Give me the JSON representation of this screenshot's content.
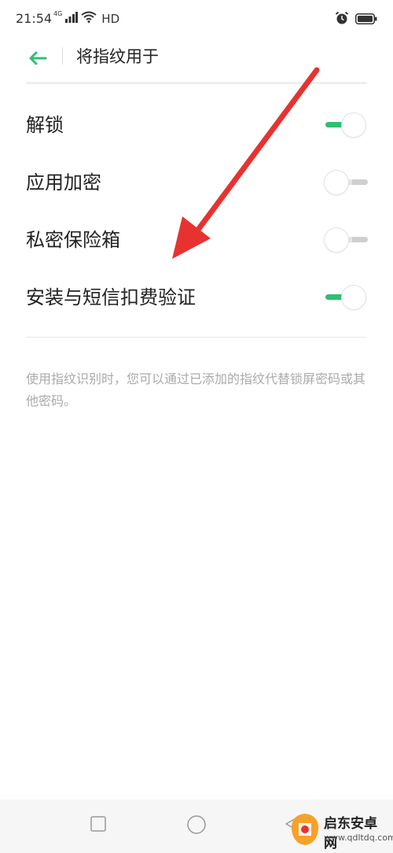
{
  "status_bar": {
    "time": "21:54",
    "network": "4G",
    "hd": "HD",
    "icons": [
      "signal-icon",
      "wifi-icon",
      "alarm-icon",
      "battery-icon"
    ]
  },
  "header": {
    "back_icon": "arrow-left-icon",
    "title": "将指纹用于"
  },
  "settings": [
    {
      "label": "解锁",
      "enabled": true
    },
    {
      "label": "应用加密",
      "enabled": false
    },
    {
      "label": "私密保险箱",
      "enabled": false
    },
    {
      "label": "安装与短信扣费验证",
      "enabled": true
    }
  ],
  "footnote": "使用指纹识别时，您可以通过已添加的指纹代替锁屏密码或其他密码。",
  "nav_bar": {
    "icons": [
      "square-icon",
      "circle-icon",
      "triangle-icon"
    ]
  },
  "watermark": {
    "title": "启东安卓网",
    "url": "www.qdltdq.com"
  },
  "colors": {
    "accent": "#2fbf71",
    "arrow": "#e8322f",
    "footnote": "#aaaaaa"
  }
}
